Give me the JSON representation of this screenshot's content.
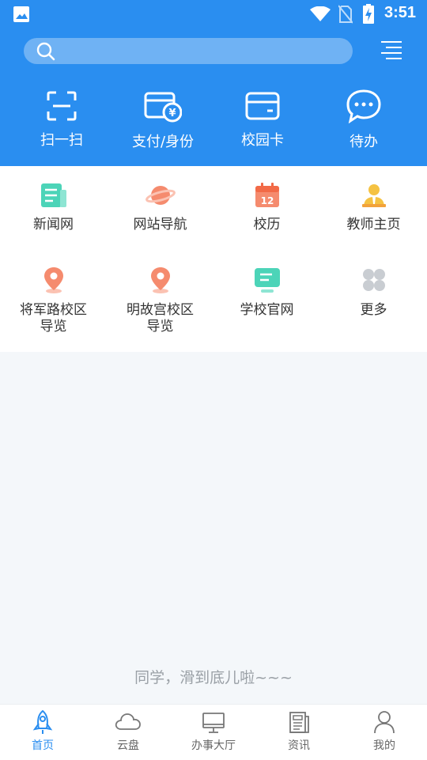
{
  "status": {
    "time": "3:51"
  },
  "quick_actions": [
    {
      "label": "扫一扫",
      "icon": "scan-icon"
    },
    {
      "label": "支付/身份",
      "icon": "wallet-yen-icon"
    },
    {
      "label": "校园卡",
      "icon": "card-icon"
    },
    {
      "label": "待办",
      "icon": "chat-bubble-icon"
    }
  ],
  "grid_items": [
    {
      "label": "新闻网",
      "icon": "newspaper-icon",
      "color": "#4cd4b8"
    },
    {
      "label": "网站导航",
      "icon": "planet-icon",
      "color": "#f58b6e"
    },
    {
      "label": "校历",
      "icon": "calendar-icon",
      "color": "#f58b6e",
      "calendar_day": "12"
    },
    {
      "label": "教师主页",
      "icon": "teacher-icon",
      "color": "#f5c242"
    },
    {
      "label": "将军路校区\n导览",
      "icon": "location-pin-icon",
      "color": "#f58b6e"
    },
    {
      "label": "明故宫校区\n导览",
      "icon": "location-pin-icon",
      "color": "#f58b6e"
    },
    {
      "label": "学校官网",
      "icon": "monitor-icon",
      "color": "#4cd4b8"
    },
    {
      "label": "更多",
      "icon": "more-grid-icon",
      "color": "#c9cdd2"
    }
  ],
  "footer_note": "同学，滑到底儿啦~~~",
  "tabs": [
    {
      "label": "首页",
      "icon": "rocket-icon",
      "active": true
    },
    {
      "label": "云盘",
      "icon": "cloud-icon",
      "active": false
    },
    {
      "label": "办事大厅",
      "icon": "desktop-icon",
      "active": false
    },
    {
      "label": "资讯",
      "icon": "news-icon",
      "active": false
    },
    {
      "label": "我的",
      "icon": "user-icon",
      "active": false
    }
  ],
  "colors": {
    "primary": "#2a8ef0",
    "search_bg": "#6fb2f4",
    "page_bg": "#f4f7fa"
  }
}
